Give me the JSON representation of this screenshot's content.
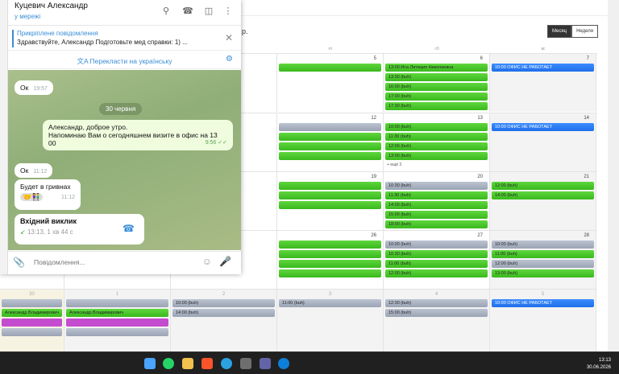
{
  "calendar": {
    "title_fragment": "р.",
    "view_month": "Месяц",
    "view_week": "Неделя",
    "dow": [
      "",
      "пт",
      "сб",
      "вс"
    ],
    "weeks": [
      {
        "nums": [
          "",
          "",
          "",
          "5",
          "6",
          "7"
        ],
        "col3": [
          [
            "g",
            "13:00 Иса Литиция Николаевна"
          ],
          [
            "g",
            "13:30 (buh)"
          ],
          [
            "g",
            "16:00 (buh)"
          ],
          [
            "g",
            "17:00 (buh)"
          ],
          [
            "g",
            "17:30 (buh)"
          ]
        ],
        "col4": [
          [
            "b",
            "10:00 ОФИС НЕ РАБОТАЕТ"
          ]
        ],
        "col2": [
          [
            "g",
            ""
          ]
        ],
        "more": ""
      },
      {
        "nums": [
          "",
          "",
          "",
          "12",
          "13",
          "14"
        ],
        "col3": [
          [
            "g",
            "10:00 (buh)"
          ],
          [
            "g",
            "11:30 (buh)"
          ],
          [
            "g",
            "12:00 (buh)"
          ],
          [
            "g",
            "13:00 (buh)"
          ]
        ],
        "col4": [
          [
            "b",
            "10:00 ОФИС НЕ РАБОТАЕТ"
          ]
        ],
        "col2": [
          [
            "gr",
            ""
          ],
          [
            "g",
            ""
          ],
          [
            "g",
            ""
          ],
          [
            "g",
            ""
          ]
        ],
        "more": "+ ещё 3"
      },
      {
        "nums": [
          "",
          "",
          "",
          "19",
          "20",
          "21"
        ],
        "col3": [
          [
            "gr",
            "10:30 (buh)"
          ],
          [
            "g",
            "11:30 (buh)"
          ],
          [
            "g",
            "14:00 (buh)"
          ],
          [
            "g",
            "15:00 (buh)"
          ],
          [
            "g",
            "18:00 (buh)"
          ]
        ],
        "col4": [
          [
            "g",
            "12:00 (buh)"
          ],
          [
            "g",
            "14:00 (buh)"
          ]
        ],
        "col2": [
          [
            "g",
            ""
          ],
          [
            "g",
            ""
          ],
          [
            "g",
            ""
          ]
        ],
        "more": ""
      },
      {
        "nums": [
          "",
          "",
          "",
          "26",
          "27",
          "28"
        ],
        "col3": [
          [
            "gr",
            "10:00 (buh)"
          ],
          [
            "g",
            "10:30 (buh)"
          ],
          [
            "g",
            "11:00 (buh)"
          ],
          [
            "g",
            "12:00 (buh)"
          ]
        ],
        "col4": [
          [
            "gr",
            "10:00 (buh)"
          ],
          [
            "g",
            "11:00 (buh)"
          ],
          [
            "gr",
            "12:00 (buh)"
          ],
          [
            "g",
            "13:00 (buh)"
          ]
        ],
        "col2": [
          [
            "g",
            ""
          ],
          [
            "g",
            ""
          ],
          [
            "g",
            ""
          ],
          [
            "g",
            ""
          ]
        ],
        "more": ""
      },
      {
        "nums": [
          "30",
          "1",
          "2",
          "3",
          "4",
          "5"
        ],
        "col0": [
          [
            "gr",
            ""
          ],
          [
            "g",
            "Александр Владимирович"
          ],
          [
            "pu",
            ""
          ],
          [
            "gr",
            ""
          ]
        ],
        "col1": [
          [
            "gr",
            "10:00 (buh)"
          ],
          [
            "gr",
            "14:00 (buh)"
          ]
        ],
        "col2": [
          [
            "gr",
            "11:00 (buh)"
          ]
        ],
        "col3": [
          [
            "gr",
            "12:30 (buh)"
          ],
          [
            "gr",
            "15:00 (buh)"
          ]
        ],
        "col4": [
          [
            "b",
            "10:00 ОФИС НЕ РАБОТАЕТ"
          ]
        ],
        "more": ""
      }
    ]
  },
  "telegram": {
    "contact_name": "Куцевич Александр",
    "status": "у мережі",
    "pinned_title": "Прикріплене повідомлення",
    "pinned_text": "Здравствуйте, Александр Подготовьте мед справки: 1) ...",
    "translate_label": "Перекласти на українську",
    "messages": {
      "ok1_text": "Ок",
      "ok1_time": "19:57",
      "date_divider": "30 червня",
      "out_line1": "Александр, доброе утро.",
      "out_line2": "Напоминаю Вам о сегодняшнем визите в офис на 13",
      "out_line3": "00",
      "out_time": "9:56",
      "ok2_text": "Ок",
      "ok2_time": "11:12",
      "uah_text": "Будет в гривнах",
      "uah_time": "11:12",
      "call_title": "Вхідний виклик",
      "call_details": "13:13, 1 хв 44 с"
    },
    "input_placeholder": "Повідомлення..."
  },
  "taskbar": {
    "time": "13:13",
    "date": "30.06.2026"
  }
}
